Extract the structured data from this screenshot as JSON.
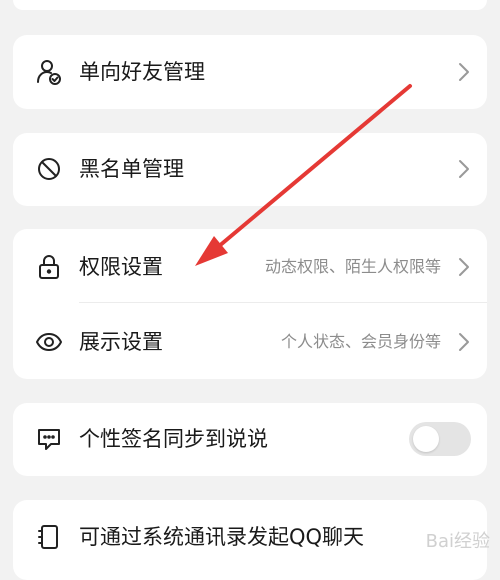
{
  "items": {
    "oneway_friends": {
      "label": "单向好友管理",
      "icon": "person-check-icon"
    },
    "blacklist": {
      "label": "黑名单管理",
      "icon": "block-icon"
    },
    "permissions": {
      "label": "权限设置",
      "hint": "动态权限、陌生人权限等",
      "icon": "lock-icon"
    },
    "display": {
      "label": "展示设置",
      "hint": "个人状态、会员身份等",
      "icon": "eye-icon"
    },
    "signature_sync": {
      "label": "个性签名同步到说说",
      "icon": "chat-bubble-icon",
      "toggle_on": false
    },
    "contacts_chat": {
      "label": "可通过系统通讯录发起QQ聊天",
      "icon": "contacts-book-icon"
    }
  },
  "watermark": {
    "text": "Bai经验"
  },
  "colors": {
    "arrow": "#e53935",
    "background": "#f2f2f2",
    "card": "#ffffff",
    "hint": "#8c8c8c"
  }
}
